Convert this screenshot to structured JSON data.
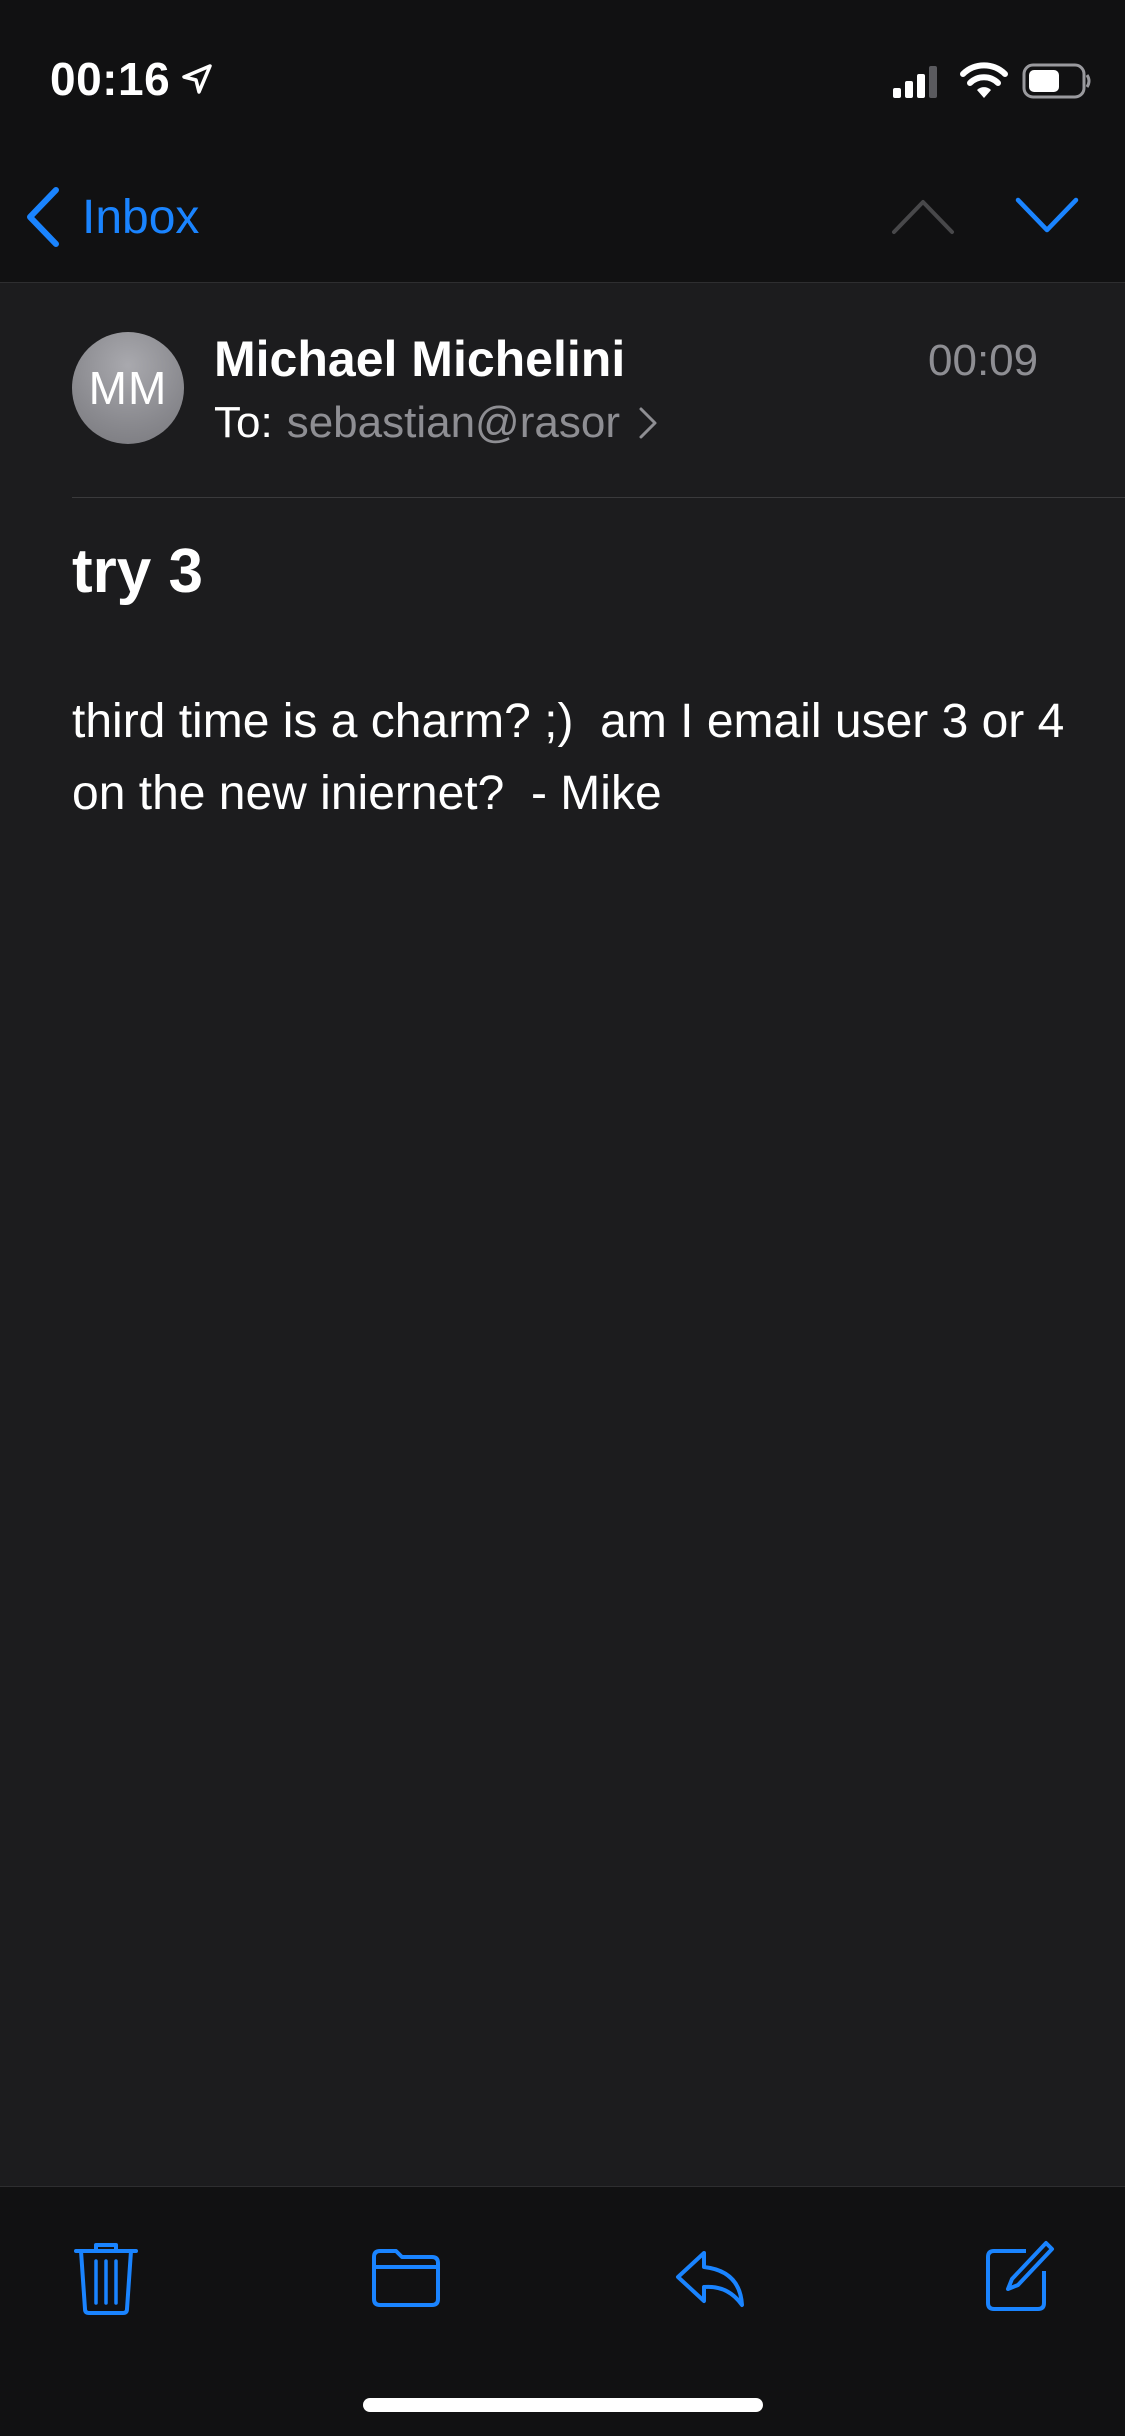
{
  "status_bar": {
    "time": "00:16",
    "icons": [
      "location-arrow-icon",
      "cellular-signal-icon",
      "wifi-icon",
      "battery-icon"
    ]
  },
  "nav": {
    "back_label": "Inbox",
    "icons": [
      "chevron-left-icon",
      "chevron-up-icon",
      "chevron-down-icon"
    ]
  },
  "message": {
    "avatar_initials": "MM",
    "sender": "Michael Michelini",
    "time": "00:09",
    "to_label": "To:",
    "to_address": "sebastian@rasor",
    "subject": "try 3",
    "body": "third time is a charm? ;)  am I email user 3 or 4 on the new iniernet?  - Mike"
  },
  "toolbar": {
    "icons": [
      "trash-icon",
      "folder-icon",
      "reply-icon",
      "compose-icon"
    ]
  },
  "colors": {
    "accent": "#1a84ff",
    "background": "#1c1c1e",
    "bar_background": "#111112",
    "secondary_text": "#8e8e93",
    "disabled": "#48484a"
  }
}
